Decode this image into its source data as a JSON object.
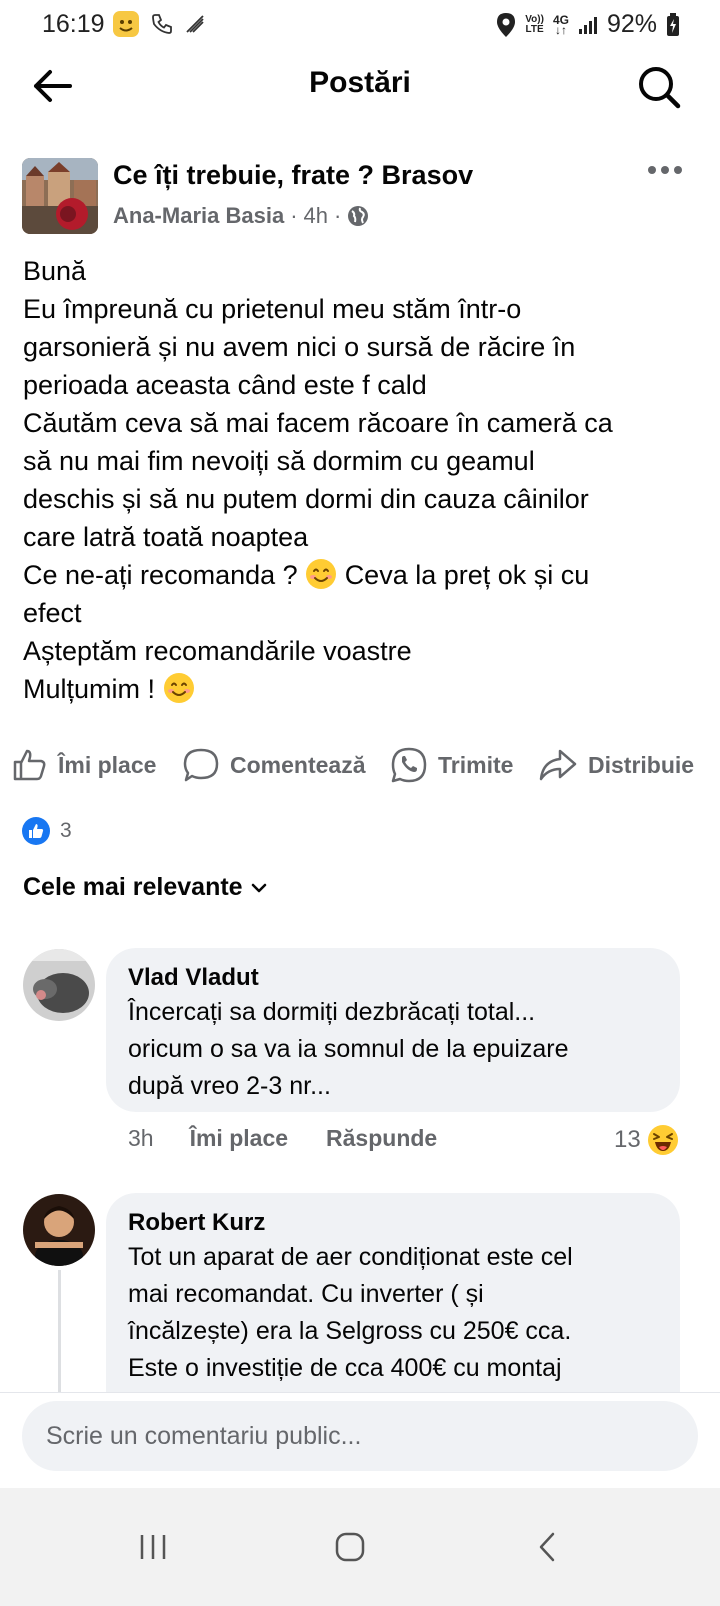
{
  "status_bar": {
    "time": "16:19",
    "network_top": "Vo))",
    "network_bottom": "LTE",
    "data_top": "4G",
    "data_bottom": "↓↑",
    "battery_percent": "92%"
  },
  "header": {
    "title": "Postări"
  },
  "post": {
    "group_name": "Ce îți trebuie, frate ? Brasov",
    "author": "Ana-Maria Basia",
    "separator": "·",
    "time": "4h",
    "lines": [
      "Bună",
      "Eu împreună cu prietenul meu stăm într-o",
      "garsonieră și nu avem nici o sursă de răcire în",
      "perioada aceasta când este f cald",
      "Căutăm ceva să mai facem răcoare în cameră ca",
      "să nu mai fim nevoiți să dormim cu geamul",
      "deschis și să nu putem dormi din cauza câinilor",
      "care latră toată noaptea"
    ],
    "line_recommend_a": "Ce ne-ați recomanda ?",
    "line_recommend_b": "Ceva la preț ok și cu",
    "line_effect": "efect",
    "line_waiting": "Așteptăm recomandările voastre",
    "line_thanks": "Mulțumim !",
    "emoji_name": "smiling-face-emoji"
  },
  "actions": {
    "like": "Îmi place",
    "comment": "Comentează",
    "send": "Trimite",
    "share": "Distribuie"
  },
  "reactions": {
    "count": "3"
  },
  "sort": {
    "label": "Cele mai relevante"
  },
  "comments": [
    {
      "name": "Vlad Vladut",
      "lines": [
        "Încercați sa dormiți dezbrăcați total...",
        "oricum o sa va ia somnul de la epuizare",
        "după vreo 2-3 nr..."
      ],
      "time": "3h",
      "like": "Îmi place",
      "reply": "Răspunde",
      "reaction_count": "13",
      "reaction_icon": "laughing-emoji"
    },
    {
      "name": "Robert Kurz",
      "lines": [
        "Tot un aparat de aer condiționat este cel",
        "mai recomandat. Cu inverter ( și",
        "încălzește) era la Selgross cu 250€ cca.",
        "Este o investiție de cca 400€ cu montaj"
      ]
    }
  ],
  "composer": {
    "placeholder": "Scrie un comentariu public..."
  },
  "colors": {
    "accent_blue": "#1877f2",
    "secondary_text": "#65676b",
    "bubble_bg": "#f0f2f5",
    "emoji_yellow": "#ffcc33"
  }
}
